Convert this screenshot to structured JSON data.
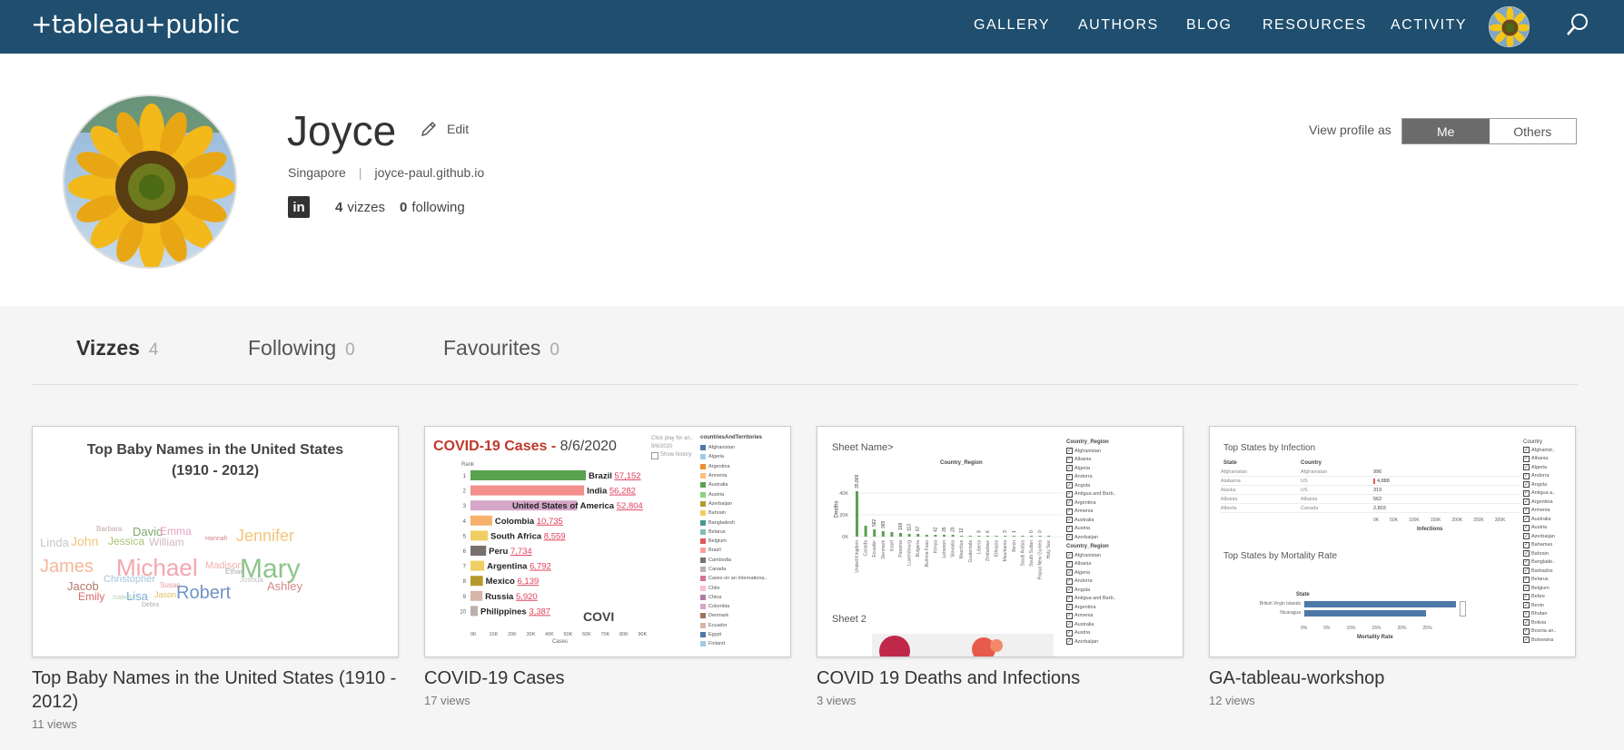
{
  "header": {
    "logo": "+tableau+public",
    "nav": [
      "GALLERY",
      "AUTHORS",
      "BLOG",
      "RESOURCES",
      "ACTIVITY"
    ]
  },
  "profile": {
    "name": "Joyce",
    "edit_label": "Edit",
    "location": "Singapore",
    "website": "joyce-paul.github.io",
    "linkedin": "in",
    "vizzes_count": "4",
    "vizzes_label": "vizzes",
    "following_count": "0",
    "following_label": "following",
    "view_as_label": "View profile as",
    "view_as_options": [
      "Me",
      "Others"
    ]
  },
  "tabs": [
    {
      "label": "Vizzes",
      "count": "4"
    },
    {
      "label": "Following",
      "count": "0"
    },
    {
      "label": "Favourites",
      "count": "0"
    }
  ],
  "cards": [
    {
      "title": "Top Baby Names in the United States (1910 - 2012)",
      "views": "11 views",
      "thumb_title_1": "Top Baby Names in the United States",
      "thumb_title_2": "(1910 - 2012)"
    },
    {
      "title": "COVID-19 Cases",
      "views": "17 views",
      "thumb_title": "COVID-19 Cases - ",
      "thumb_date": "8/6/2020",
      "thumb_play": "Click play for an..",
      "thumb_date_small": "8/6/2020",
      "thumb_history": "Show history",
      "thumb_legend_title": "countriesAndTerritories",
      "thumb_rank": "Rank",
      "thumb_axis": "Cases",
      "thumb_watermark": "COVI",
      "legend": [
        "Afghanistan",
        "Algeria",
        "Argentina",
        "Armenia",
        "Australia",
        "Austria",
        "Azerbaijan",
        "Bahrain",
        "Bangladesh",
        "Belarus",
        "Belgium",
        "Brazil",
        "Cambodia",
        "Canada",
        "Cases on an Internationa..",
        "Chile",
        "China",
        "Colombia",
        "Denmark",
        "Ecuador",
        "Egypt",
        "Finland"
      ],
      "bars": [
        {
          "rank": "1",
          "label": "Brazil",
          "value": "57,152",
          "color": "#59a14f"
        },
        {
          "rank": "2",
          "label": "India",
          "value": "56,282",
          "color": "#f28e8c"
        },
        {
          "rank": "3",
          "label": "United States of America",
          "value": "52,804",
          "color": "#d4a6c8"
        },
        {
          "rank": "4",
          "label": "Colombia",
          "value": "10,735",
          "color": "#f6b26b"
        },
        {
          "rank": "5",
          "label": "South Africa",
          "value": "8,559",
          "color": "#f1ce63"
        },
        {
          "rank": "6",
          "label": "Peru",
          "value": "7,734",
          "color": "#79706e"
        },
        {
          "rank": "7",
          "label": "Argentina",
          "value": "6,792",
          "color": "#f1ce63"
        },
        {
          "rank": "8",
          "label": "Mexico",
          "value": "6,139",
          "color": "#b6992d"
        },
        {
          "rank": "9",
          "label": "Russia",
          "value": "5,920",
          "color": "#d7b5a6"
        },
        {
          "rank": "10",
          "label": "Philippines",
          "value": "3,387",
          "color": "#bab0ac"
        }
      ],
      "ticks": [
        "0K",
        "10K",
        "20K",
        "30K",
        "40K",
        "50K",
        "60K",
        "70K",
        "80K",
        "90K"
      ]
    },
    {
      "title": "COVID 19 Deaths and Infections",
      "views": "3 views",
      "sheet1": "Sheet Name>",
      "sheet2": "Sheet 2",
      "header": "Country_Region",
      "ylabel": "Deaths",
      "yticks": [
        "40K",
        "20K",
        "0K"
      ],
      "filter_title": "Country_Region",
      "filter_items": [
        "Afghanistan",
        "Albania",
        "Algeria",
        "Andorra",
        "Angola",
        "Antigua and Barb..",
        "Argentina",
        "Armenia",
        "Australia",
        "Austria",
        "Azerbaijan"
      ],
      "filter2_items": [
        "Afghanistan",
        "Albania",
        "Algeria",
        "Andorra",
        "Angola",
        "Antigua and Barb..",
        "Argentina",
        "Armenia",
        "Australia",
        "Austria",
        "Azerbaijan"
      ],
      "xcats": [
        "United Kingdom",
        "Canada",
        "Ecuador",
        "Denmark",
        "Israel",
        "Panama",
        "Luxembourg",
        "Bulgaria",
        "Burkina Faso",
        "Kenya",
        "Lebanon",
        "Slovakia",
        "Mauritius",
        "Guatemala",
        "Liberia",
        "Zimbabwe",
        "Ethiopia",
        "Mauritania",
        "Benin",
        "Saudi Arabia",
        "South Sudan",
        "Papua New Guinea",
        "Holy See"
      ],
      "xvals": [
        "35,869",
        "",
        "582",
        "365",
        "",
        "168",
        "113",
        "67",
        "",
        "42",
        "35",
        "20",
        "12",
        "",
        "9",
        "6",
        "",
        "3",
        "1",
        "",
        "0",
        "0",
        ""
      ]
    },
    {
      "title": "GA-tableau-workshop",
      "views": "12 views",
      "sec1": "Top States by Infection",
      "sec2": "Top States by Mortality Rate",
      "col_state": "State",
      "col_country": "Country",
      "rows": [
        {
          "state": "Afghanistan",
          "country": "Afghanistan",
          "value": "996"
        },
        {
          "state": "Alabama",
          "country": "US",
          "value": "4,888"
        },
        {
          "state": "Alaska",
          "country": "US",
          "value": "319"
        },
        {
          "state": "Albania",
          "country": "Albania",
          "value": "562"
        },
        {
          "state": "Alberta",
          "country": "Canada",
          "value": "2,803"
        }
      ],
      "infect_ticks": [
        "0K",
        "50K",
        "100K",
        "150K",
        "200K",
        "250K",
        "300K"
      ],
      "infect_label": "Infections",
      "mort_state": "State",
      "mort_rows": [
        "British Virgin Islands",
        "Nicaragua"
      ],
      "mort_ticks": [
        "0%",
        "5%",
        "10%",
        "15%",
        "20%",
        "25%"
      ],
      "mort_label": "Mortality Rate",
      "filter_title": "Country",
      "filter_items": [
        "Afghanist..",
        "Albania",
        "Algeria",
        "Andorra",
        "Angola",
        "Antigua a..",
        "Argentina",
        "Armenia",
        "Australia",
        "Austria",
        "Azerbaijan",
        "Bahamas",
        "Bahrain",
        "Banglade..",
        "Barbados",
        "Belarus",
        "Belgium",
        "Belize",
        "Benin",
        "Bhutan",
        "Bolivia",
        "Bosnia an..",
        "Botswana"
      ]
    }
  ],
  "wordcloud": [
    {
      "w": "Mary",
      "size": 30,
      "color": "#8dc58a"
    },
    {
      "w": "Michael",
      "size": 26,
      "color": "#f4a6ae"
    },
    {
      "w": "James",
      "size": 20,
      "color": "#f4b89a"
    },
    {
      "w": "Robert",
      "size": 20,
      "color": "#6f94c4"
    },
    {
      "w": "Jennifer",
      "size": 18,
      "color": "#f3c57b"
    },
    {
      "w": "John",
      "size": 14,
      "color": "#f3c57b"
    },
    {
      "w": "David",
      "size": 13,
      "color": "#7fa86b"
    },
    {
      "w": "Linda",
      "size": 13,
      "color": "#c7c7c7"
    },
    {
      "w": "Jessica",
      "size": 12,
      "color": "#a9c36f"
    },
    {
      "w": "William",
      "size": 12,
      "color": "#d4b8c8"
    },
    {
      "w": "Emma",
      "size": 12,
      "color": "#e8a0c0"
    },
    {
      "w": "Jacob",
      "size": 13,
      "color": "#b07a6a"
    },
    {
      "w": "Christopher",
      "size": 11,
      "color": "#a3c4dc"
    },
    {
      "w": "Ashley",
      "size": 13,
      "color": "#d48a8a"
    },
    {
      "w": "Madison",
      "size": 11,
      "color": "#f2b2b2"
    },
    {
      "w": "Lisa",
      "size": 13,
      "color": "#7aaed4"
    },
    {
      "w": "Emily",
      "size": 12,
      "color": "#d46a6a"
    },
    {
      "w": "Jason",
      "size": 9,
      "color": "#e0c060"
    },
    {
      "w": "Joshua",
      "size": 8,
      "color": "#c0c0c0"
    },
    {
      "w": "Ethan",
      "size": 8,
      "color": "#aaa"
    },
    {
      "w": "Susan",
      "size": 8,
      "color": "#e89a9a"
    },
    {
      "w": "Barbara",
      "size": 8,
      "color": "#c7a8a8"
    },
    {
      "w": "Isabella",
      "size": 7,
      "color": "#b5d0b5"
    },
    {
      "w": "Hannah",
      "size": 7,
      "color": "#c88"
    },
    {
      "w": "Debra",
      "size": 7,
      "color": "#aaa"
    }
  ]
}
